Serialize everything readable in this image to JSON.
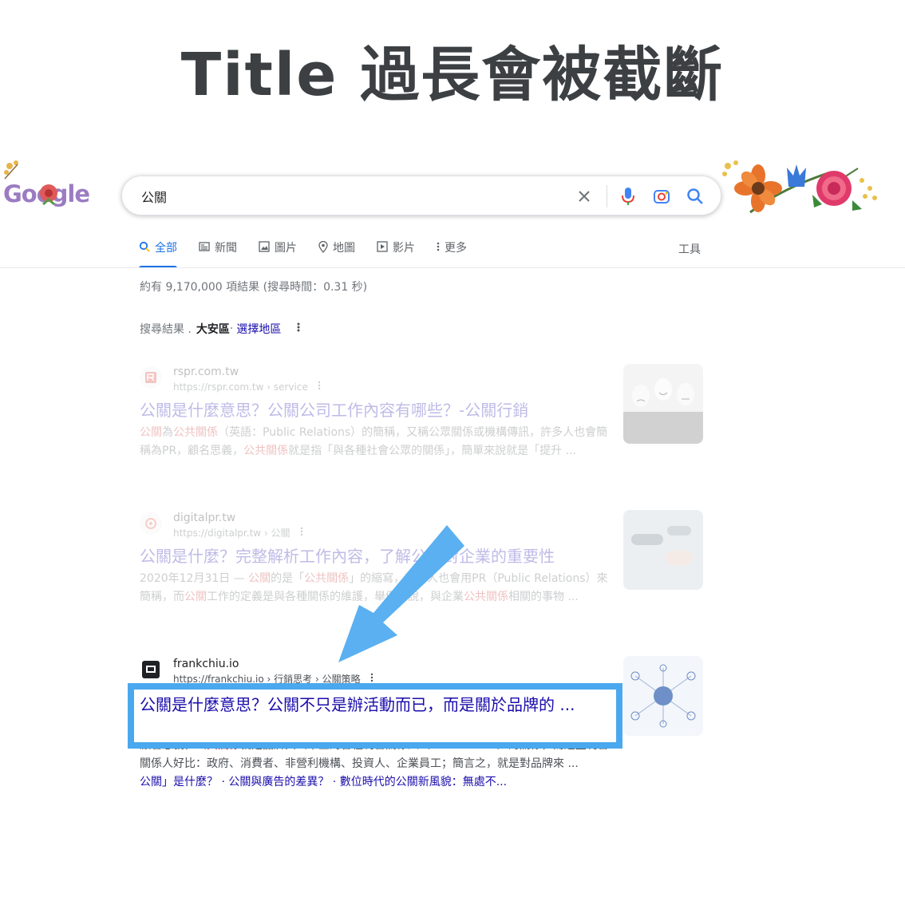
{
  "slide": {
    "title": "Title 過長會被截斷"
  },
  "google": {
    "logo_text": "Google",
    "search_query": "公關",
    "tabs": [
      {
        "label": "全部",
        "icon": "search-icon",
        "active": true
      },
      {
        "label": "新聞",
        "icon": "newspaper-icon"
      },
      {
        "label": "圖片",
        "icon": "image-icon"
      },
      {
        "label": "地圖",
        "icon": "map-pin-icon"
      },
      {
        "label": "影片",
        "icon": "play-icon"
      },
      {
        "label": "更多",
        "icon": "more-vert-icon"
      }
    ],
    "tools_label": "工具",
    "result_stats": "約有 9,170,000 項結果 (搜尋時間：0.31 秒)",
    "local": {
      "prefix": "搜尋結果 .",
      "location": "大安區",
      "sep": " · ",
      "link": "選擇地區"
    }
  },
  "results": [
    {
      "site_name": "rspr.com.tw",
      "url": "https://rspr.com.tw › service",
      "title": "公關是什麼意思？公關公司工作內容有哪些？-公關行銷",
      "snippet_parts": [
        {
          "t": "公關",
          "hl": true
        },
        {
          "t": "為",
          "hl": false
        },
        {
          "t": "公共關係",
          "hl": true
        },
        {
          "t": "（英語：Public Relations）的簡稱，又稱公眾關係或機構傳訊，許多人也會簡稱為PR，顧名思義，",
          "hl": false
        },
        {
          "t": "公共關係",
          "hl": true
        },
        {
          "t": "就是指「與各種社會公眾的關係」，簡單來說就是「提升 ...",
          "hl": false
        }
      ]
    },
    {
      "site_name": "digitalpr.tw",
      "url": "https://digitalpr.tw › 公關",
      "title": "公關是什麼？完整解析工作內容，了解公關對企業的重要性",
      "snippet_parts": [
        {
          "t": "2020年12月31日 — ",
          "hl": false
        },
        {
          "t": "公關",
          "hl": true
        },
        {
          "t": "的是「",
          "hl": false
        },
        {
          "t": "公共關係",
          "hl": true
        },
        {
          "t": "」的縮寫，許多人也會用PR（Public Relations）來簡稱，而",
          "hl": false
        },
        {
          "t": "公關",
          "hl": true
        },
        {
          "t": "工作的定義是與各種關係的維護，舉例來說，與企業",
          "hl": false
        },
        {
          "t": "公共關係",
          "hl": true
        },
        {
          "t": "相關的事物 ...",
          "hl": false
        }
      ]
    },
    {
      "site_name": "frankchiu.io",
      "url": "https://frankchiu.io › 行銷思考 › 公關策略",
      "title": "公關是什麼意思？公關不只是辦活動而已，而是關於品牌的 ...",
      "snippet_parts": [
        {
          "t": "顧名思義，",
          "hl": false
        },
        {
          "t": "公共關係",
          "hl": true
        },
        {
          "t": "就是品牌與公眾上的各種利害關係人（Stakeholder）的關係，而這些利害關係人好比：政府、消費者、非營利機構、投資人、企業員工；簡言之，就是對品牌來 ...",
          "hl": false
        }
      ],
      "sitelinks": "公關」是什麼？ · 公關與廣告的差異？ · 數位時代的公關新風貌：無處不..."
    }
  ],
  "colors": {
    "accent": "#1a73e8",
    "link": "#1a0dab",
    "highlight_box": "#4aa8ee",
    "arrow": "#5ab0f0"
  }
}
